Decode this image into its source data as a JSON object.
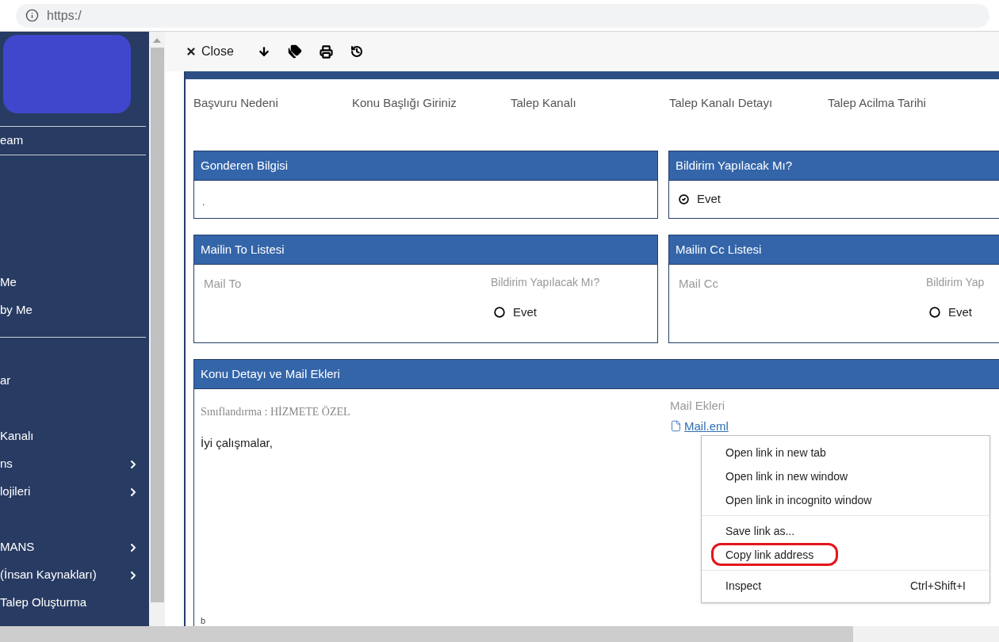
{
  "browser": {
    "url": "https:/"
  },
  "sidebar": {
    "items": [
      {
        "label": "eam",
        "has_submenu": false
      },
      {
        "label": "Me",
        "has_submenu": false
      },
      {
        "label": "by Me",
        "has_submenu": false
      },
      {
        "label": "ar",
        "has_submenu": false
      },
      {
        "label": "Kanalı",
        "has_submenu": false
      },
      {
        "label": "ns",
        "has_submenu": true
      },
      {
        "label": "lojileri",
        "has_submenu": true
      },
      {
        "label": "MANS",
        "has_submenu": true
      },
      {
        "label": "(İnsan Kaynakları)",
        "has_submenu": true
      },
      {
        "label": "Talep Oluşturma",
        "has_submenu": false
      }
    ]
  },
  "toolbar": {
    "close_label": "Close"
  },
  "fields": [
    "Başvuru Nedeni",
    "Konu Başlığı Giriniz",
    "Talep Kanalı",
    "Talep Kanalı Detayı",
    "Talep Acilma Tarihi"
  ],
  "sender_panel": {
    "title": "Gonderen Bilgisi",
    "value": "."
  },
  "notify_panel": {
    "title": "Bildirim Yapılacak Mı?",
    "option": "Evet",
    "checked": true
  },
  "to_panel": {
    "title": "Mailin To Listesi",
    "column": "Mail To",
    "notify_label": "Bildirim Yapılacak Mı?",
    "option": "Evet",
    "checked": false
  },
  "cc_panel": {
    "title": "Mailin Cc Listesi",
    "column": "Mail Cc",
    "notify_label": "Bildirim Yap",
    "option": "Evet",
    "checked": false
  },
  "detail_panel": {
    "title": "Konu Detayı ve Mail Ekleri",
    "classification": "Sınıflandırma : HİZMETE ÖZEL",
    "body": "İyi çalışmalar,",
    "footer_mark": "b",
    "attachments_label": "Mail Ekleri",
    "attachment": "Mail.eml"
  },
  "context_menu": {
    "groups": [
      [
        {
          "label": "Open link in new tab",
          "highlighted": false
        },
        {
          "label": "Open link in new window",
          "highlighted": false
        },
        {
          "label": "Open link in incognito window",
          "highlighted": false
        }
      ],
      [
        {
          "label": "Save link as...",
          "highlighted": false
        },
        {
          "label": "Copy link address",
          "highlighted": true
        }
      ],
      [
        {
          "label": "Inspect",
          "shortcut": "Ctrl+Shift+I",
          "highlighted": false
        }
      ]
    ]
  }
}
